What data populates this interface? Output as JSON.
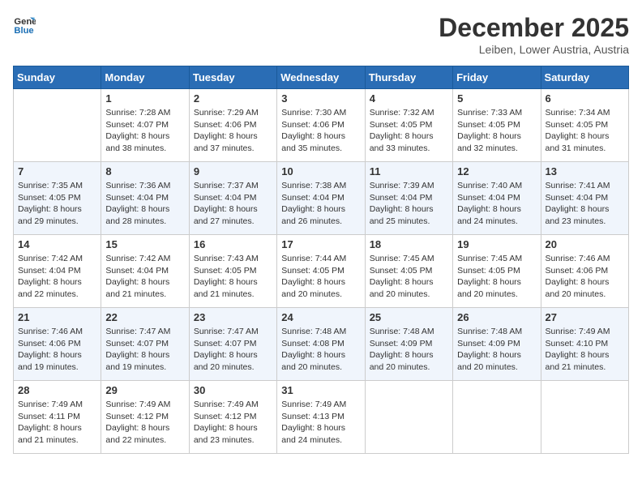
{
  "header": {
    "logo_line1": "General",
    "logo_line2": "Blue",
    "month": "December 2025",
    "location": "Leiben, Lower Austria, Austria"
  },
  "weekdays": [
    "Sunday",
    "Monday",
    "Tuesday",
    "Wednesday",
    "Thursday",
    "Friday",
    "Saturday"
  ],
  "weeks": [
    [
      {
        "day": "",
        "sunrise": "",
        "sunset": "",
        "daylight": ""
      },
      {
        "day": "1",
        "sunrise": "Sunrise: 7:28 AM",
        "sunset": "Sunset: 4:07 PM",
        "daylight": "Daylight: 8 hours and 38 minutes."
      },
      {
        "day": "2",
        "sunrise": "Sunrise: 7:29 AM",
        "sunset": "Sunset: 4:06 PM",
        "daylight": "Daylight: 8 hours and 37 minutes."
      },
      {
        "day": "3",
        "sunrise": "Sunrise: 7:30 AM",
        "sunset": "Sunset: 4:06 PM",
        "daylight": "Daylight: 8 hours and 35 minutes."
      },
      {
        "day": "4",
        "sunrise": "Sunrise: 7:32 AM",
        "sunset": "Sunset: 4:05 PM",
        "daylight": "Daylight: 8 hours and 33 minutes."
      },
      {
        "day": "5",
        "sunrise": "Sunrise: 7:33 AM",
        "sunset": "Sunset: 4:05 PM",
        "daylight": "Daylight: 8 hours and 32 minutes."
      },
      {
        "day": "6",
        "sunrise": "Sunrise: 7:34 AM",
        "sunset": "Sunset: 4:05 PM",
        "daylight": "Daylight: 8 hours and 31 minutes."
      }
    ],
    [
      {
        "day": "7",
        "sunrise": "Sunrise: 7:35 AM",
        "sunset": "Sunset: 4:05 PM",
        "daylight": "Daylight: 8 hours and 29 minutes."
      },
      {
        "day": "8",
        "sunrise": "Sunrise: 7:36 AM",
        "sunset": "Sunset: 4:04 PM",
        "daylight": "Daylight: 8 hours and 28 minutes."
      },
      {
        "day": "9",
        "sunrise": "Sunrise: 7:37 AM",
        "sunset": "Sunset: 4:04 PM",
        "daylight": "Daylight: 8 hours and 27 minutes."
      },
      {
        "day": "10",
        "sunrise": "Sunrise: 7:38 AM",
        "sunset": "Sunset: 4:04 PM",
        "daylight": "Daylight: 8 hours and 26 minutes."
      },
      {
        "day": "11",
        "sunrise": "Sunrise: 7:39 AM",
        "sunset": "Sunset: 4:04 PM",
        "daylight": "Daylight: 8 hours and 25 minutes."
      },
      {
        "day": "12",
        "sunrise": "Sunrise: 7:40 AM",
        "sunset": "Sunset: 4:04 PM",
        "daylight": "Daylight: 8 hours and 24 minutes."
      },
      {
        "day": "13",
        "sunrise": "Sunrise: 7:41 AM",
        "sunset": "Sunset: 4:04 PM",
        "daylight": "Daylight: 8 hours and 23 minutes."
      }
    ],
    [
      {
        "day": "14",
        "sunrise": "Sunrise: 7:42 AM",
        "sunset": "Sunset: 4:04 PM",
        "daylight": "Daylight: 8 hours and 22 minutes."
      },
      {
        "day": "15",
        "sunrise": "Sunrise: 7:42 AM",
        "sunset": "Sunset: 4:04 PM",
        "daylight": "Daylight: 8 hours and 21 minutes."
      },
      {
        "day": "16",
        "sunrise": "Sunrise: 7:43 AM",
        "sunset": "Sunset: 4:05 PM",
        "daylight": "Daylight: 8 hours and 21 minutes."
      },
      {
        "day": "17",
        "sunrise": "Sunrise: 7:44 AM",
        "sunset": "Sunset: 4:05 PM",
        "daylight": "Daylight: 8 hours and 20 minutes."
      },
      {
        "day": "18",
        "sunrise": "Sunrise: 7:45 AM",
        "sunset": "Sunset: 4:05 PM",
        "daylight": "Daylight: 8 hours and 20 minutes."
      },
      {
        "day": "19",
        "sunrise": "Sunrise: 7:45 AM",
        "sunset": "Sunset: 4:05 PM",
        "daylight": "Daylight: 8 hours and 20 minutes."
      },
      {
        "day": "20",
        "sunrise": "Sunrise: 7:46 AM",
        "sunset": "Sunset: 4:06 PM",
        "daylight": "Daylight: 8 hours and 20 minutes."
      }
    ],
    [
      {
        "day": "21",
        "sunrise": "Sunrise: 7:46 AM",
        "sunset": "Sunset: 4:06 PM",
        "daylight": "Daylight: 8 hours and 19 minutes."
      },
      {
        "day": "22",
        "sunrise": "Sunrise: 7:47 AM",
        "sunset": "Sunset: 4:07 PM",
        "daylight": "Daylight: 8 hours and 19 minutes."
      },
      {
        "day": "23",
        "sunrise": "Sunrise: 7:47 AM",
        "sunset": "Sunset: 4:07 PM",
        "daylight": "Daylight: 8 hours and 20 minutes."
      },
      {
        "day": "24",
        "sunrise": "Sunrise: 7:48 AM",
        "sunset": "Sunset: 4:08 PM",
        "daylight": "Daylight: 8 hours and 20 minutes."
      },
      {
        "day": "25",
        "sunrise": "Sunrise: 7:48 AM",
        "sunset": "Sunset: 4:09 PM",
        "daylight": "Daylight: 8 hours and 20 minutes."
      },
      {
        "day": "26",
        "sunrise": "Sunrise: 7:48 AM",
        "sunset": "Sunset: 4:09 PM",
        "daylight": "Daylight: 8 hours and 20 minutes."
      },
      {
        "day": "27",
        "sunrise": "Sunrise: 7:49 AM",
        "sunset": "Sunset: 4:10 PM",
        "daylight": "Daylight: 8 hours and 21 minutes."
      }
    ],
    [
      {
        "day": "28",
        "sunrise": "Sunrise: 7:49 AM",
        "sunset": "Sunset: 4:11 PM",
        "daylight": "Daylight: 8 hours and 21 minutes."
      },
      {
        "day": "29",
        "sunrise": "Sunrise: 7:49 AM",
        "sunset": "Sunset: 4:12 PM",
        "daylight": "Daylight: 8 hours and 22 minutes."
      },
      {
        "day": "30",
        "sunrise": "Sunrise: 7:49 AM",
        "sunset": "Sunset: 4:12 PM",
        "daylight": "Daylight: 8 hours and 23 minutes."
      },
      {
        "day": "31",
        "sunrise": "Sunrise: 7:49 AM",
        "sunset": "Sunset: 4:13 PM",
        "daylight": "Daylight: 8 hours and 24 minutes."
      },
      {
        "day": "",
        "sunrise": "",
        "sunset": "",
        "daylight": ""
      },
      {
        "day": "",
        "sunrise": "",
        "sunset": "",
        "daylight": ""
      },
      {
        "day": "",
        "sunrise": "",
        "sunset": "",
        "daylight": ""
      }
    ]
  ]
}
